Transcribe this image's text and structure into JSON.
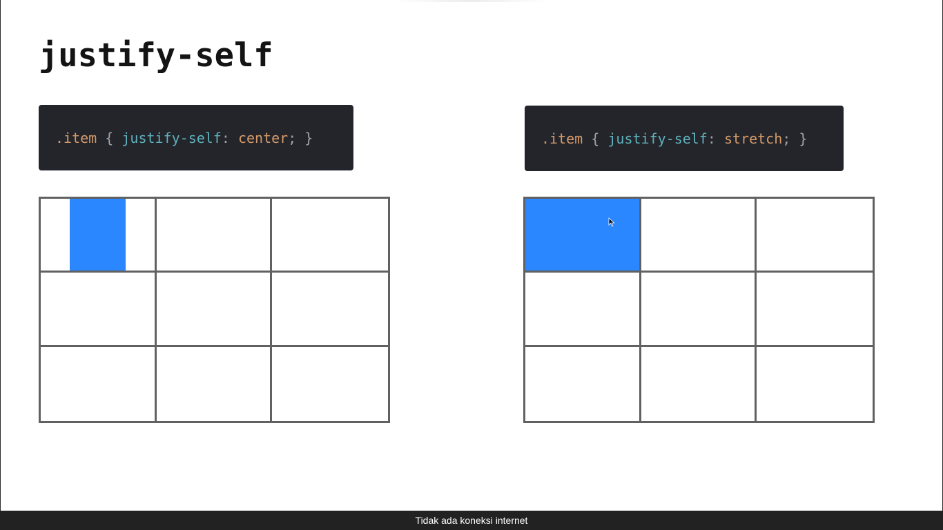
{
  "slide": {
    "title": "justify-self"
  },
  "examples": [
    {
      "code": {
        "selector": ".item",
        "open_brace": "{",
        "property": "justify-self",
        "colon": ":",
        "value": "center",
        "semicolon": ";",
        "close_brace": "}"
      },
      "grid": {
        "rows": 3,
        "columns": 3,
        "item_mode": "center"
      }
    },
    {
      "code": {
        "selector": ".item",
        "open_brace": "{",
        "property": "justify-self",
        "colon": ":",
        "value": "stretch",
        "semicolon": ";",
        "close_brace": "}"
      },
      "grid": {
        "rows": 3,
        "columns": 3,
        "item_mode": "stretch"
      }
    }
  ],
  "colors": {
    "code_background": "#23252b",
    "selector": "#d59a6a",
    "property": "#5fb2bd",
    "value": "#d59a6a",
    "grid_line": "#616161",
    "item_fill": "#2b87ff"
  },
  "icons": {
    "cursor": "mouse-pointer-icon"
  },
  "status_bar": {
    "message": "Tidak ada koneksi internet"
  }
}
